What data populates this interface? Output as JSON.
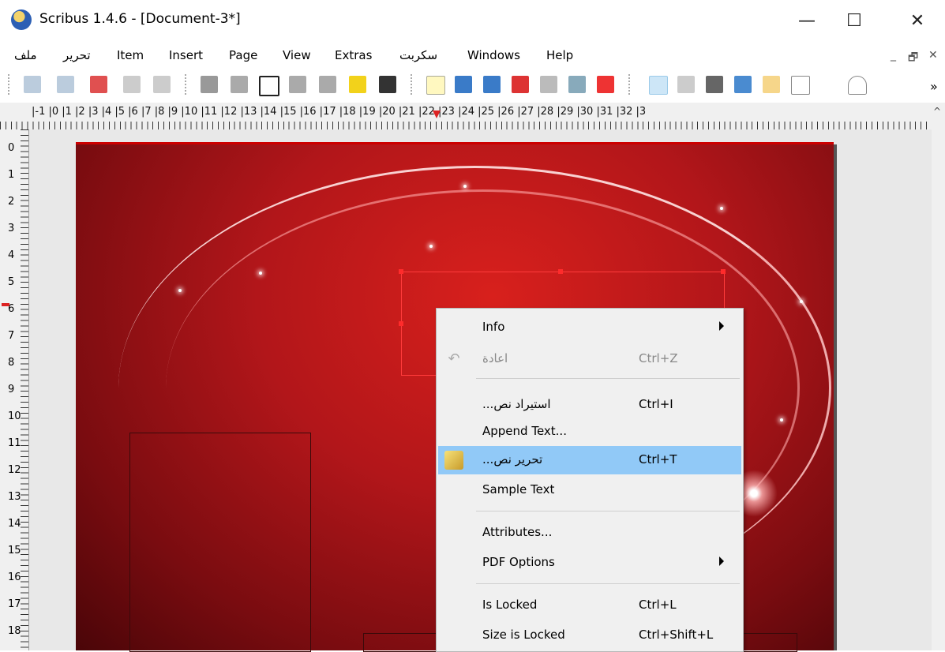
{
  "window": {
    "title": "Scribus 1.4.6 - [Document-3*]",
    "minimize_glyph": "—",
    "maximize_glyph": "☐",
    "close_glyph": "✕"
  },
  "menubar": {
    "items": [
      "ملف",
      "تحرير",
      "Item",
      "Insert",
      "Page",
      "View",
      "Extras",
      "سكربت",
      "Windows",
      "Help"
    ],
    "mdi_min": "_",
    "mdi_restore": "🗗",
    "mdi_close": "✕"
  },
  "toolbar": {
    "more": "»",
    "icons": [
      "undo-icon",
      "redo-icon",
      "cut-icon",
      "copy-icon",
      "paste-icon",
      "pdf-push-button-icon",
      "pdf-text-field-icon",
      "pdf-checkbox-icon",
      "pdf-combo-box-icon",
      "pdf-list-box-icon",
      "text-annotation-icon",
      "link-annotation-icon",
      "new-document-icon",
      "open-document-icon",
      "save-document-icon",
      "close-document-icon",
      "print-icon",
      "preflight-icon",
      "export-pdf-icon",
      "select-tool-icon",
      "text-frame-icon",
      "image-frame-icon",
      "render-frame-icon",
      "table-icon",
      "shape-icon",
      "polygon-icon"
    ]
  },
  "ruler": {
    "h_numbers": "|-1 |0 |1 |2 |3 |4 |5 |6 |7 |8 |9 |10 |11 |12 |13 |14 |15 |16 |17 |18 |19 |20 |21 |22 |23 |24 |25 |26 |27 |28 |29 |30 |31 |32 |3",
    "v_numbers": [
      "0",
      "1",
      "2",
      "3",
      "4",
      "5",
      "6",
      "7",
      "8",
      "9",
      "10",
      "11",
      "12",
      "13",
      "14",
      "15",
      "16",
      "17",
      "18"
    ]
  },
  "context_menu": {
    "items": [
      {
        "label": "Info",
        "shortcut": "",
        "submenu": true
      },
      {
        "label": "اعادة",
        "shortcut": "Ctrl+Z",
        "disabled": true
      },
      {
        "label": "...استيراد نص",
        "shortcut": "Ctrl+I"
      },
      {
        "label": "Append Text...",
        "shortcut": ""
      },
      {
        "label": "...تحرير نص",
        "shortcut": "Ctrl+T",
        "highlighted": true
      },
      {
        "label": "Sample Text",
        "shortcut": ""
      },
      {
        "label": "Attributes...",
        "shortcut": ""
      },
      {
        "label": "PDF Options",
        "shortcut": "",
        "submenu": true
      },
      {
        "label": "Is Locked",
        "shortcut": "Ctrl+L"
      },
      {
        "label": "Size is Locked",
        "shortcut": "Ctrl+Shift+L"
      }
    ]
  },
  "colors": {
    "highlight": "#91c9f7",
    "page_red": "#c41b1b"
  }
}
